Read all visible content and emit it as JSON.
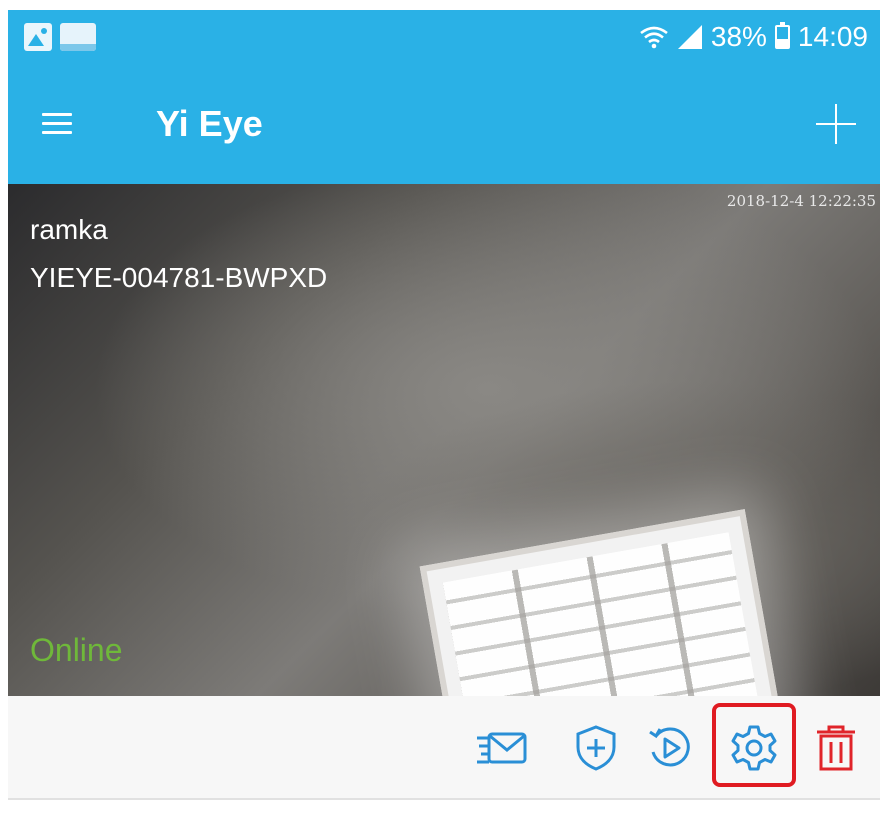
{
  "status_bar": {
    "notification_icons": [
      "gallery-icon",
      "orange-icon"
    ],
    "battery_percent": "38%",
    "battery_level": 0.38,
    "time": "14:09"
  },
  "app_bar": {
    "title": "Yi Eye",
    "menu_icon": "hamburger-menu-icon",
    "add_icon": "plus-icon"
  },
  "camera": {
    "timestamp": "2018-12-4 12:22:35",
    "name": "ramka",
    "device_id": "YIEYE-004781-BWPXD",
    "status": "Online"
  },
  "actions": [
    {
      "icon": "message-icon"
    },
    {
      "icon": "shield-plus-icon"
    },
    {
      "icon": "playback-icon"
    },
    {
      "icon": "settings-gear-icon",
      "highlighted": true
    },
    {
      "icon": "trash-icon"
    }
  ],
  "colors": {
    "brand": "#2ab1e6",
    "action_icon": "#2a8fd6",
    "delete": "#e0242a",
    "online": "#6fb83a",
    "highlight": "#e01b22"
  }
}
